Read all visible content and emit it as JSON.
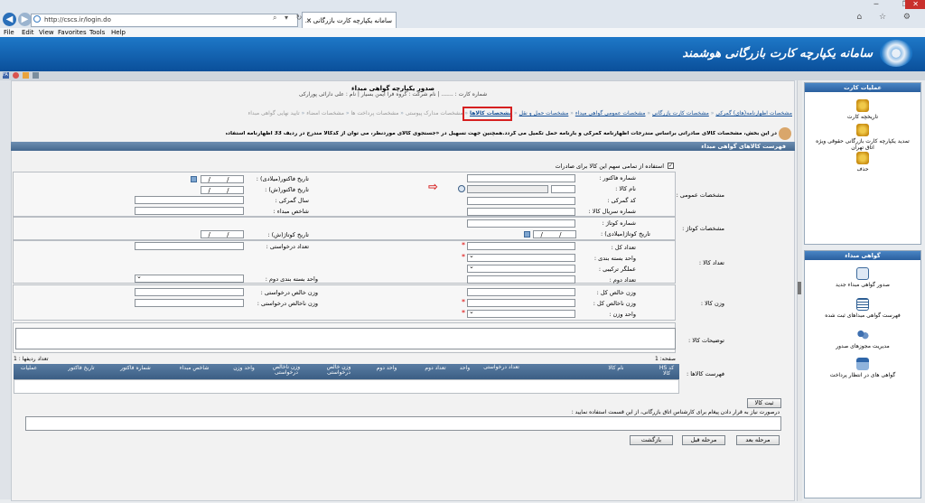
{
  "browser": {
    "url": "http://cscs.ir/login.do",
    "tab_title": "سامانه یکپارچه کارت بازرگانی ...",
    "menu": [
      "File",
      "Edit",
      "View",
      "Favorites",
      "Tools",
      "Help"
    ]
  },
  "header": {
    "site_name": "سامانه یکپارچه کارت بازرگانی هوشمند"
  },
  "page": {
    "title": "صدور یکپارچه گواهی مبداء",
    "info_line": "شماره کارت : ....... | نام شرکت : گروه فرا ایمن بسیار | نام : علی دارائی پورارکی"
  },
  "steps": [
    {
      "label": "مشخصات اظهارنامه(های) گمرکی",
      "state": "done"
    },
    {
      "label": "مشخصات کارت بازرگانی",
      "state": "done"
    },
    {
      "label": "مشخصات عمومی گواهی مبداء",
      "state": "done"
    },
    {
      "label": "مشخصات حمل و نقل",
      "state": "done"
    },
    {
      "label": "مشخصات کالاها",
      "state": "active"
    },
    {
      "label": "مشخصات مدارک پیوستی",
      "state": "pending"
    },
    {
      "label": "مشخصات پرداخت ها",
      "state": "pending"
    },
    {
      "label": "مشخصات امضاء",
      "state": "pending"
    },
    {
      "label": "تایید نهایی گواهی مبداء",
      "state": "pending"
    }
  ],
  "notice": "در این بخش، مشخصات کالای صادراتی براساس مندرجات اظهارنامه گمرکی و بارنامه حمل تکمیل می گردد.همچنین جهت تسهیل در «جستجوی کالای موردنظر، می توان از کدکالا مندرج در ردیف 33 اظهارنامه استفاده نمود.",
  "section_title": "فهرست کالاهای گواهی مبداء",
  "form": {
    "quota_checkbox": "استفاده از تمامی سهم این کالا برای صادرات",
    "groups": {
      "general": "مشخصات عمومی :",
      "package": "مشخصات کوتاژ :",
      "count": "تعداد کالا :",
      "weight": "وزن کالا :",
      "desc": "توضیحات کالا :",
      "list": "فهرست کالاها :"
    },
    "labels": {
      "invoice_no": "شماره فاکتور :",
      "goods_name": "نام کالا :",
      "customs_code": "کد گمرکی :",
      "serial_no": "شماره سریال کالا :",
      "invoice_date_g": "تاریخ فاکتور(میلادی) :",
      "invoice_date_s": "تاریخ فاکتور(ش) :",
      "customs_year": "سال گمرکی :",
      "origin_index": "شاخص مبداء :",
      "cotage_no": "شماره کوتاژ :",
      "cotage_date_g": "تاریخ کوتاژ(میلادی) :",
      "cotage_date_s": "تاریخ کوتاژ(ش) :",
      "total_count": "تعداد کل :",
      "pack_unit": "واحد بسته بندی :",
      "composite": "عملگر ترکیبی :",
      "second_count": "تعداد دوم :",
      "requested_count": "تعداد درخواستی :",
      "second_pack_unit": "واحد بسته بندی دوم :",
      "gross_weight": "وزن خالص کل :",
      "net_weight": "وزن ناخالص کل :",
      "weight_unit": "واحد وزن :",
      "gross_requested": "وزن خالص درخواستی :",
      "net_requested": "وزن ناخالص درخواستی :"
    },
    "date_placeholder": "/ /"
  },
  "grid": {
    "page_label": "صفحه: 1",
    "rows_label": "تعداد ردیفها : 1",
    "columns": [
      "کد HS کالا",
      "نام کالا",
      "تعداد درخواستی",
      "واحد",
      "تعداد دوم",
      "واحد دوم",
      "وزن خالص درخواستی",
      "وزن ناخالص درخواستی",
      "واحد وزن",
      "شاخص مبداء",
      "شماره فاکتور",
      "تاریخ فاکتور",
      "عملیات"
    ]
  },
  "register_button": "ثبت کالا",
  "message_label": "درصورت نیاز به قرار دادن پیغام برای کارشناس اتاق بازرگانی، از این قسمت استفاده نمایید :",
  "buttons": {
    "next": "مرحله بعد",
    "prev": "مرحله قبل",
    "back": "بازگشت"
  },
  "sidebar": {
    "card_header": "عملیات کارت",
    "card_items": [
      {
        "label": "تاریخچه کارت",
        "icon": "coins-icon"
      },
      {
        "label": "تمدید یکپارچه کارت بازرگانی حقوقی ویژه اتاق تهران",
        "icon": "coins-icon"
      },
      {
        "label": "حذف",
        "icon": "coins-icon"
      }
    ],
    "origin_header": "گواهی مبداء",
    "origin_items": [
      {
        "label": "صدور گواهی مبداء جدید",
        "icon": "certificate-icon"
      },
      {
        "label": "فهرست گواهی مبداهای ثبت شده",
        "icon": "list-icon"
      },
      {
        "label": "مدیریت مجوزهای صدور",
        "icon": "users-icon"
      },
      {
        "label": "گواهی های در انتظار پرداخت",
        "icon": "card-icon"
      }
    ]
  },
  "colors": {
    "banner": "#0a4f9a",
    "header": "#45688f",
    "link": "#124e96",
    "highlight": "#d62020"
  }
}
